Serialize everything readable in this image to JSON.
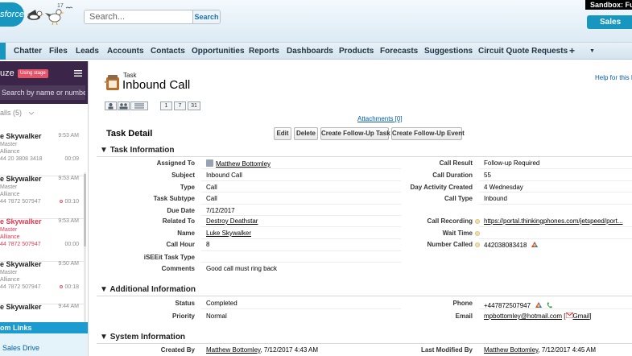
{
  "header": {
    "logo_text": "sforce",
    "mascot_number": "17",
    "search": {
      "placeholder": "Search...",
      "button_label": "Search"
    },
    "sandbox_label": "Sandbox: Fu",
    "app_label": "Sales"
  },
  "nav": {
    "tabs": [
      {
        "label": "Chatter"
      },
      {
        "label": "Files"
      },
      {
        "label": "Leads"
      },
      {
        "label": "Accounts"
      },
      {
        "label": "Contacts"
      },
      {
        "label": "Opportunities"
      },
      {
        "label": "Reports"
      },
      {
        "label": "Dashboards"
      },
      {
        "label": "Products"
      },
      {
        "label": "Forecasts"
      },
      {
        "label": "Suggestions"
      },
      {
        "label": "Circuit Quote Requests"
      }
    ],
    "add_tab_glyph": "+",
    "more_glyph": "▼"
  },
  "sidebar": {
    "app_name": "uze",
    "stage_badge": "Using stage",
    "search_placeholder": "Search by name or number",
    "calls_header": "alls (5)",
    "calls": [
      {
        "name": "e Skywalker",
        "time": "9:53 AM",
        "line2": "Master",
        "line3": "Alliance",
        "line4": "44 20 3808 3418",
        "duration": "00:09",
        "rec": false,
        "missed": false
      },
      {
        "name": "e Skywalker",
        "time": "9:53 AM",
        "line2": "Master",
        "line3": "Alliance",
        "line4": "44 7872 507947",
        "duration": "00:10",
        "rec": true,
        "missed": false
      },
      {
        "name": "e Skywalker",
        "time": "9:53 AM",
        "line2": "Master",
        "line3": "Alliance",
        "line4": "44 7872 507947",
        "duration": "00:00",
        "rec": false,
        "missed": true
      },
      {
        "name": "e Skywalker",
        "time": "9:50 AM",
        "line2": "Master",
        "line3": "Alliance",
        "line4": "44 7872 507947",
        "duration": "00:18",
        "rec": true,
        "missed": false
      }
    ],
    "partial_call": {
      "name": "e Skywalker",
      "time": "9:44 AM"
    },
    "custom_links_title": "om Links",
    "custom_links": [
      {
        "label": "Sales Drive"
      }
    ]
  },
  "record": {
    "type": "Task",
    "name": "Inbound Call",
    "help_link": "Help for this P",
    "calendar_views": [
      "1",
      "7",
      "31"
    ],
    "attachments_link": "Attachments [0]",
    "detail_title": "Task Detail",
    "buttons": {
      "edit": "Edit",
      "delete": "Delete",
      "follow_up_task": "Create Follow-Up Task",
      "follow_up_event": "Create Follow-Up Event"
    }
  },
  "sections": {
    "task_info": {
      "title": "Task Information",
      "left": [
        {
          "label": "Assigned To",
          "value": "Matthew Bottomley"
        },
        {
          "label": "Subject",
          "value": "Inbound Call"
        },
        {
          "label": "Type",
          "value": "Call"
        },
        {
          "label": "Task Subtype",
          "value": "Call"
        },
        {
          "label": "Due Date",
          "value": "7/12/2017"
        },
        {
          "label": "Related To",
          "value": "Destroy Deathstar"
        },
        {
          "label": "Name",
          "value": "Luke Skywalker"
        },
        {
          "label": "Call Hour",
          "value": "8"
        },
        {
          "label": "iSEEit Task Type",
          "value": ""
        },
        {
          "label": "Comments",
          "value": "Good call must ring back"
        }
      ],
      "right": [
        {
          "label": "Call Result",
          "value": "Follow-up Required"
        },
        {
          "label": "Call Duration",
          "value": "55"
        },
        {
          "label": "Day Activity Created",
          "value": "4 Wednesday"
        },
        {
          "label": "Call Type",
          "value": "Inbound"
        },
        {
          "label": "Call Recording",
          "value": "https://portal.thinkingphones.com/jetspeed/port..."
        },
        {
          "label": "Wait Time",
          "value": ""
        },
        {
          "label": "Number Called",
          "value": "442038083418"
        }
      ]
    },
    "additional_info": {
      "title": "Additional Information",
      "left": [
        {
          "label": "Status",
          "value": "Completed"
        },
        {
          "label": "Priority",
          "value": "Normal"
        }
      ],
      "right": [
        {
          "label": "Phone",
          "value": "+447872507947"
        },
        {
          "label": "Email",
          "value": "mpbottomley@hotmail.com",
          "gmail_label": "Gmail"
        }
      ]
    },
    "system_info": {
      "title": "System Information",
      "created_by_label": "Created By",
      "created_by_user": "Matthew Bottomley",
      "created_by_date": ", 7/12/2017 4:43 AM",
      "modified_by_label": "Last Modified By",
      "modified_by_user": "Matthew Bottomley",
      "modified_by_date": ", 7/12/2017 4:45 AM"
    }
  },
  "colors": {
    "brand_blue": "#1797c0",
    "fuze_purple": "#3b2649",
    "link_blue": "#015ba7",
    "missed_red": "#e2374f"
  }
}
